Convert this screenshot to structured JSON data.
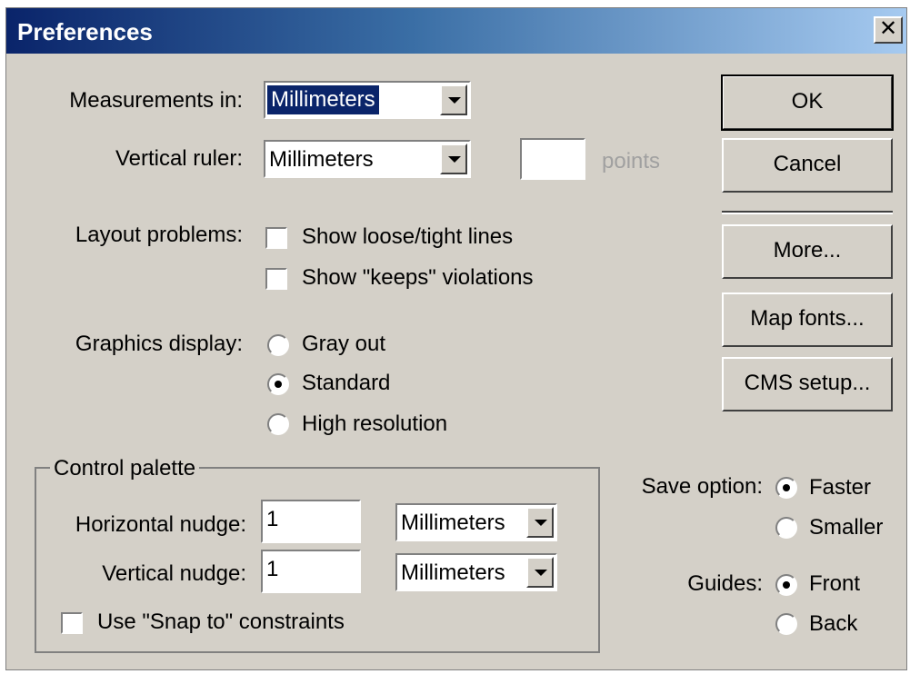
{
  "title": "Preferences",
  "close_glyph": "✕",
  "measurements": {
    "label": "Measurements in:",
    "value": "Millimeters"
  },
  "vertical_ruler": {
    "label": "Vertical ruler:",
    "value": "Millimeters",
    "points_value": "",
    "points_label": "points"
  },
  "layout_problems": {
    "label": "Layout problems:",
    "options": [
      {
        "label": "Show loose/tight lines",
        "checked": false
      },
      {
        "label": "Show \"keeps\" violations",
        "checked": false
      }
    ]
  },
  "graphics_display": {
    "label": "Graphics display:",
    "options": [
      {
        "label": "Gray out",
        "selected": false
      },
      {
        "label": "Standard",
        "selected": true
      },
      {
        "label": "High resolution",
        "selected": false
      }
    ]
  },
  "control_palette": {
    "title": "Control palette",
    "horizontal_nudge": {
      "label": "Horizontal nudge:",
      "value": "1",
      "unit": "Millimeters"
    },
    "vertical_nudge": {
      "label": "Vertical nudge:",
      "value": "1",
      "unit": "Millimeters"
    },
    "snap": {
      "label": "Use \"Snap to\" constraints",
      "checked": false
    }
  },
  "save_option": {
    "label": "Save option:",
    "options": [
      {
        "label": "Faster",
        "selected": true
      },
      {
        "label": "Smaller",
        "selected": false
      }
    ]
  },
  "guides": {
    "label": "Guides:",
    "options": [
      {
        "label": "Front",
        "selected": true
      },
      {
        "label": "Back",
        "selected": false
      }
    ]
  },
  "buttons": {
    "ok": "OK",
    "cancel": "Cancel",
    "more": "More...",
    "map_fonts": "Map fonts...",
    "cms_setup": "CMS setup..."
  },
  "colors": {
    "dialog_bg": "#d4d0c8",
    "title_start": "#0a246a",
    "title_end": "#a6caf0",
    "selection": "#0a246a"
  }
}
